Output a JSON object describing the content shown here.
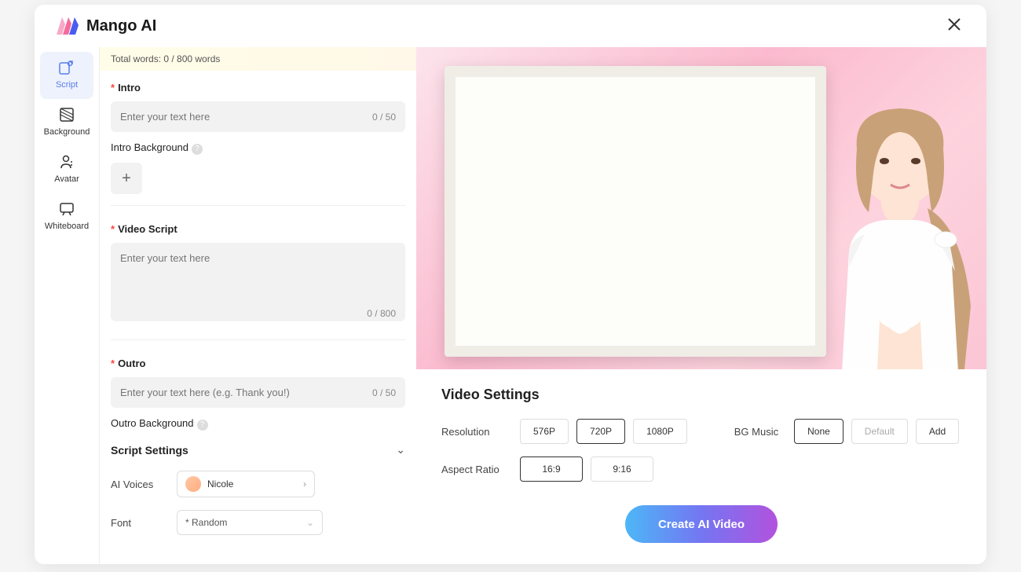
{
  "brand": "Mango AI",
  "sidebar": {
    "items": [
      {
        "label": "Script"
      },
      {
        "label": "Background"
      },
      {
        "label": "Avatar"
      },
      {
        "label": "Whiteboard"
      }
    ]
  },
  "wordCount": "Total words: 0 / 800 words",
  "intro": {
    "label": "Intro",
    "placeholder": "Enter your text here",
    "counter": "0 / 50",
    "bgLabel": "Intro Background"
  },
  "script": {
    "label": "Video Script",
    "placeholder": "Enter your text here",
    "counter": "0 / 800"
  },
  "outro": {
    "label": "Outro",
    "placeholder": "Enter your text here (e.g. Thank you!)",
    "counter": "0 / 50",
    "bgLabel": "Outro Background"
  },
  "scriptSettings": {
    "title": "Script Settings",
    "voicesLabel": "AI Voices",
    "voiceName": "Nicole",
    "fontLabel": "Font",
    "fontValue": "* Random"
  },
  "videoSettings": {
    "title": "Video Settings",
    "resolutionLabel": "Resolution",
    "resolutions": [
      "576P",
      "720P",
      "1080P"
    ],
    "bgMusicLabel": "BG Music",
    "bgMusicOptions": [
      "None",
      "Default",
      "Add"
    ],
    "aspectLabel": "Aspect Ratio",
    "aspects": [
      "16:9",
      "9:16"
    ],
    "createLabel": "Create AI Video"
  }
}
